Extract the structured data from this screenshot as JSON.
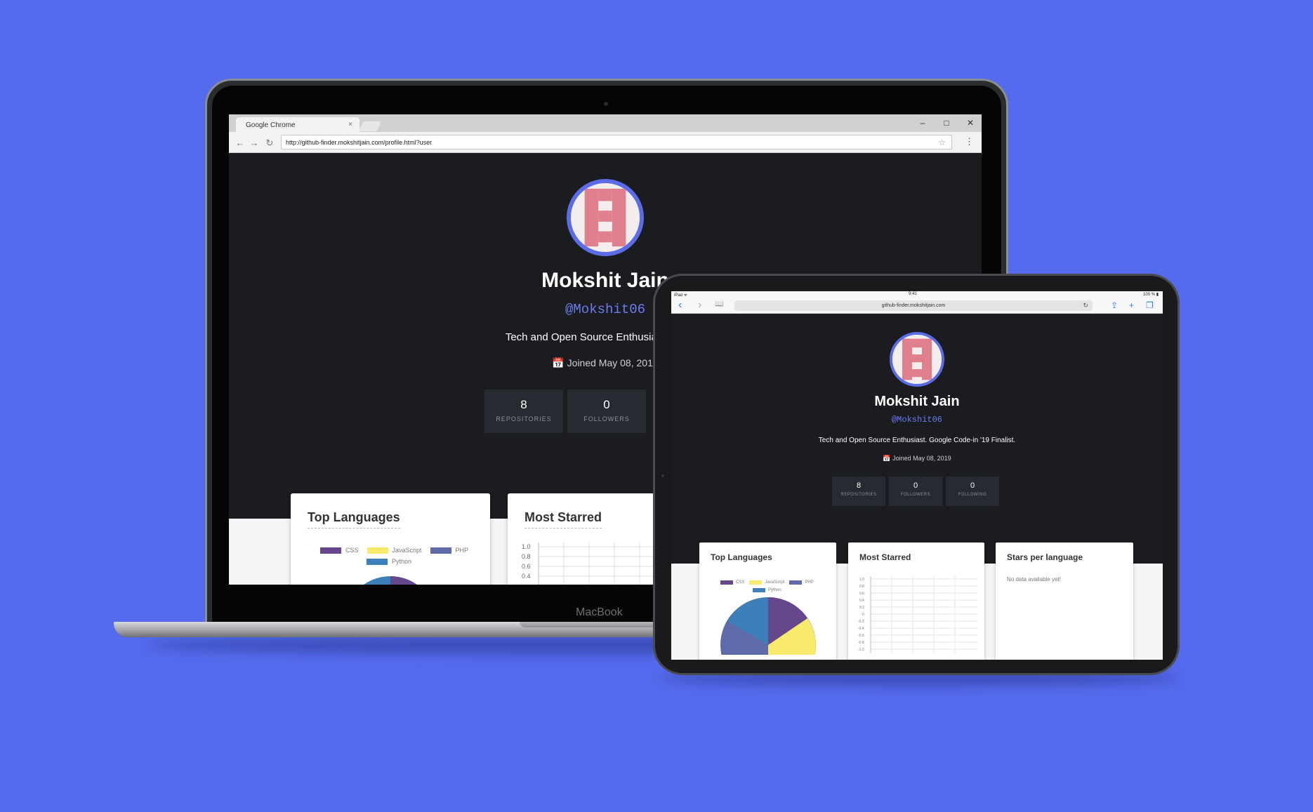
{
  "laptop": {
    "chrome": {
      "tab_title": "Google Chrome",
      "tab_close": "×",
      "url": "http://github-finder.mokshitjain.com/profile.html?user",
      "minimize": "–",
      "maximize": "□",
      "close": "✕",
      "back": "←",
      "forward": "→",
      "reload": "↻",
      "star": "☆",
      "menu": "⋮"
    },
    "profile": {
      "name": "Mokshit Jain",
      "handle": "@Mokshit06",
      "bio": "Tech and Open Source Enthusiast. Google",
      "joined": "📅 Joined May 08, 2019"
    },
    "stats": [
      {
        "value": "8",
        "label": "REPOSITORIES"
      },
      {
        "value": "0",
        "label": "FOLLOWERS"
      }
    ],
    "cards": {
      "top_languages": "Top Languages",
      "most_starred": "Most Starred"
    },
    "legend": [
      {
        "name": "CSS",
        "color": "#66478c"
      },
      {
        "name": "JavaScript",
        "color": "#f8ea6a"
      },
      {
        "name": "PHP",
        "color": "#5f6aa8"
      },
      {
        "name": "Python",
        "color": "#3d7fb9"
      }
    ],
    "most_starred_ticks": [
      "1.0",
      "0.8",
      "0.6",
      "0.4"
    ],
    "brand": "MacBook"
  },
  "ipad": {
    "status": {
      "left": "iPad ᯤ",
      "time": "9:41",
      "battery": "100 % ▮"
    },
    "safari": {
      "url": "github-finder.mokshitjain.com",
      "back": "‹",
      "forward": "›",
      "bookmarks": "📖",
      "reload": "↻",
      "share": "⇪",
      "new_tab": "+",
      "tabs": "❐"
    },
    "profile": {
      "name": "Mokshit Jain",
      "handle": "@Mokshit06",
      "bio": "Tech and Open Source Enthusiast. Google Code-in '19 Finalist.",
      "joined": "📅 Joined May 08, 2019"
    },
    "stats": [
      {
        "value": "8",
        "label": "REPOSITORIES"
      },
      {
        "value": "0",
        "label": "FOLLOWERS"
      },
      {
        "value": "0",
        "label": "FOLLOWING"
      }
    ],
    "cards": {
      "top_languages": "Top Languages",
      "most_starred": "Most Starred",
      "stars_per_language": "Stars per language",
      "no_data": "No data available yet!"
    },
    "most_starred_ticks": [
      "1.0",
      "0.8",
      "0.6",
      "0.4",
      "0.2",
      "0",
      "-0.2",
      "-0.4",
      "-0.6",
      "-0.8",
      "-1.0"
    ]
  },
  "colors": {
    "background": "#546bed",
    "accent": "#5a6ce8",
    "page_dark": "#1b1c20",
    "identicon": "#e0808f"
  }
}
